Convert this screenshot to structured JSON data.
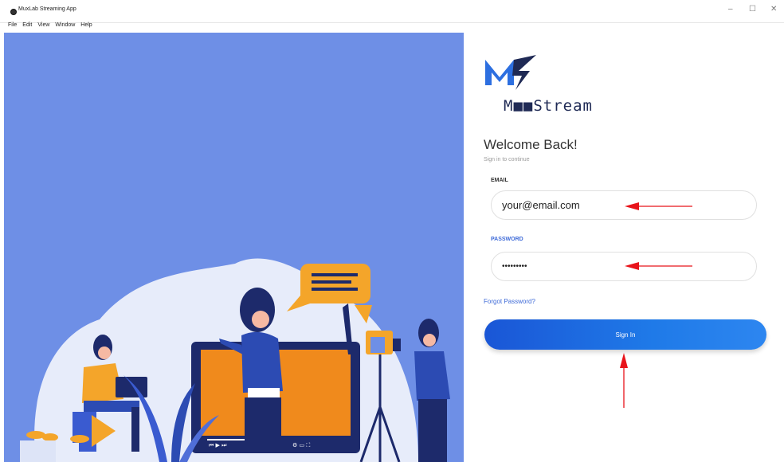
{
  "window": {
    "title": "MuxLab Streaming App",
    "controls": {
      "minimize": "–",
      "maximize": "☐",
      "close": "✕"
    }
  },
  "menu": [
    "File",
    "Edit",
    "View",
    "Window",
    "Help"
  ],
  "brand": {
    "name_prefix": "M",
    "name_blocks": "■■",
    "name_suffix": "Stream"
  },
  "login": {
    "heading": "Welcome Back!",
    "subheading": "Sign in to continue",
    "email_label": "EMAIL",
    "email_value": "your@email.com",
    "password_label": "PASSWORD",
    "password_value": "•••••••••",
    "forgot_link": "Forgot Password?",
    "signin_button": "Sign In"
  },
  "colors": {
    "hero_bg": "#6e8fe6",
    "accent": "#3f6bd8",
    "button": "#1f6ee6",
    "annotation_arrow": "#e8141b"
  }
}
